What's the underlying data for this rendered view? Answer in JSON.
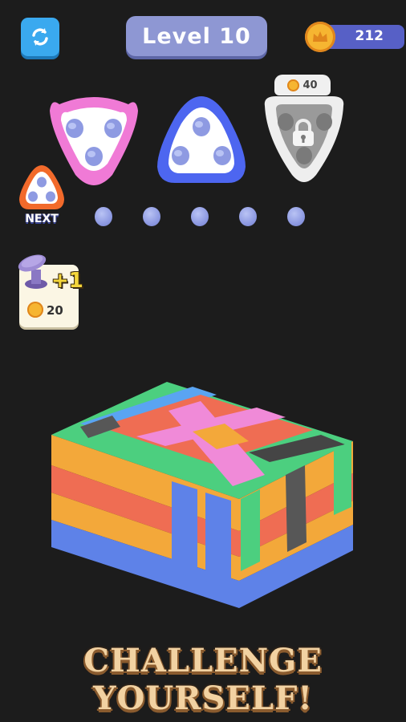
{
  "header": {
    "level_label": "Level 10",
    "coins": "212",
    "refresh_icon": "refresh-arrows-icon",
    "coin_icon": "crown-coin-icon"
  },
  "trays": [
    {
      "color": "#f07ad6",
      "state": "unlocked"
    },
    {
      "color": "#4d66f0",
      "state": "unlocked"
    },
    {
      "color": "#cfcfcf",
      "state": "locked",
      "price": "40"
    }
  ],
  "next": {
    "label": "NEXT",
    "color": "#f26a2b"
  },
  "booster": {
    "label": "+1",
    "price": "20",
    "icon": "screw-hat-icon"
  },
  "headline": "CHALLENGE YOURSELF!",
  "colors": {
    "background": "#1c1c1c",
    "accent_blue": "#3aa9ef",
    "level_pill": "#8e97d3",
    "coin_pill": "#5760c6",
    "peg": "#8e9ae2"
  }
}
